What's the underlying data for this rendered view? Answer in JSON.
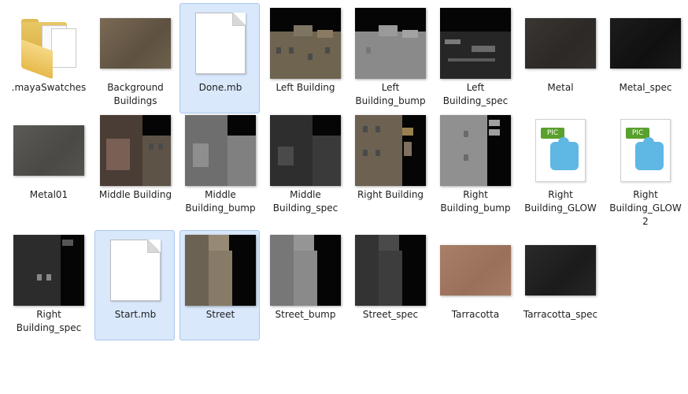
{
  "files": [
    {
      "label": ".mayaSwatches",
      "icon": "folder-icon"
    },
    {
      "label": "Background Buildings",
      "icon": "texture-thumbnail"
    },
    {
      "label": "Done.mb",
      "icon": "document-icon",
      "selected": true
    },
    {
      "label": "Left Building",
      "icon": "texture-thumbnail"
    },
    {
      "label": "Left Building_bump",
      "icon": "texture-thumbnail"
    },
    {
      "label": "Left Building_spec",
      "icon": "texture-thumbnail"
    },
    {
      "label": "Metal",
      "icon": "texture-thumbnail"
    },
    {
      "label": "Metal_spec",
      "icon": "texture-thumbnail"
    },
    {
      "label": "Metal01",
      "icon": "texture-thumbnail"
    },
    {
      "label": "Middle Building",
      "icon": "texture-thumbnail"
    },
    {
      "label": "Middle Building_bump",
      "icon": "texture-thumbnail"
    },
    {
      "label": "Middle Building_spec",
      "icon": "texture-thumbnail"
    },
    {
      "label": "Right Building",
      "icon": "texture-thumbnail"
    },
    {
      "label": "Right Building_bump",
      "icon": "texture-thumbnail"
    },
    {
      "label": "Right Building_GLOW",
      "icon": "pic-file-icon",
      "badge": "PIC"
    },
    {
      "label": "Right Building_GLOW 2",
      "icon": "pic-file-icon",
      "badge": "PIC"
    },
    {
      "label": "Right Building_spec",
      "icon": "texture-thumbnail"
    },
    {
      "label": "Start.mb",
      "icon": "document-icon",
      "selected": true
    },
    {
      "label": "Street",
      "icon": "texture-thumbnail",
      "selected": true
    },
    {
      "label": "Street_bump",
      "icon": "texture-thumbnail"
    },
    {
      "label": "Street_spec",
      "icon": "texture-thumbnail"
    },
    {
      "label": "Tarracotta",
      "icon": "texture-thumbnail"
    },
    {
      "label": "Tarracotta_spec",
      "icon": "texture-thumbnail"
    }
  ]
}
